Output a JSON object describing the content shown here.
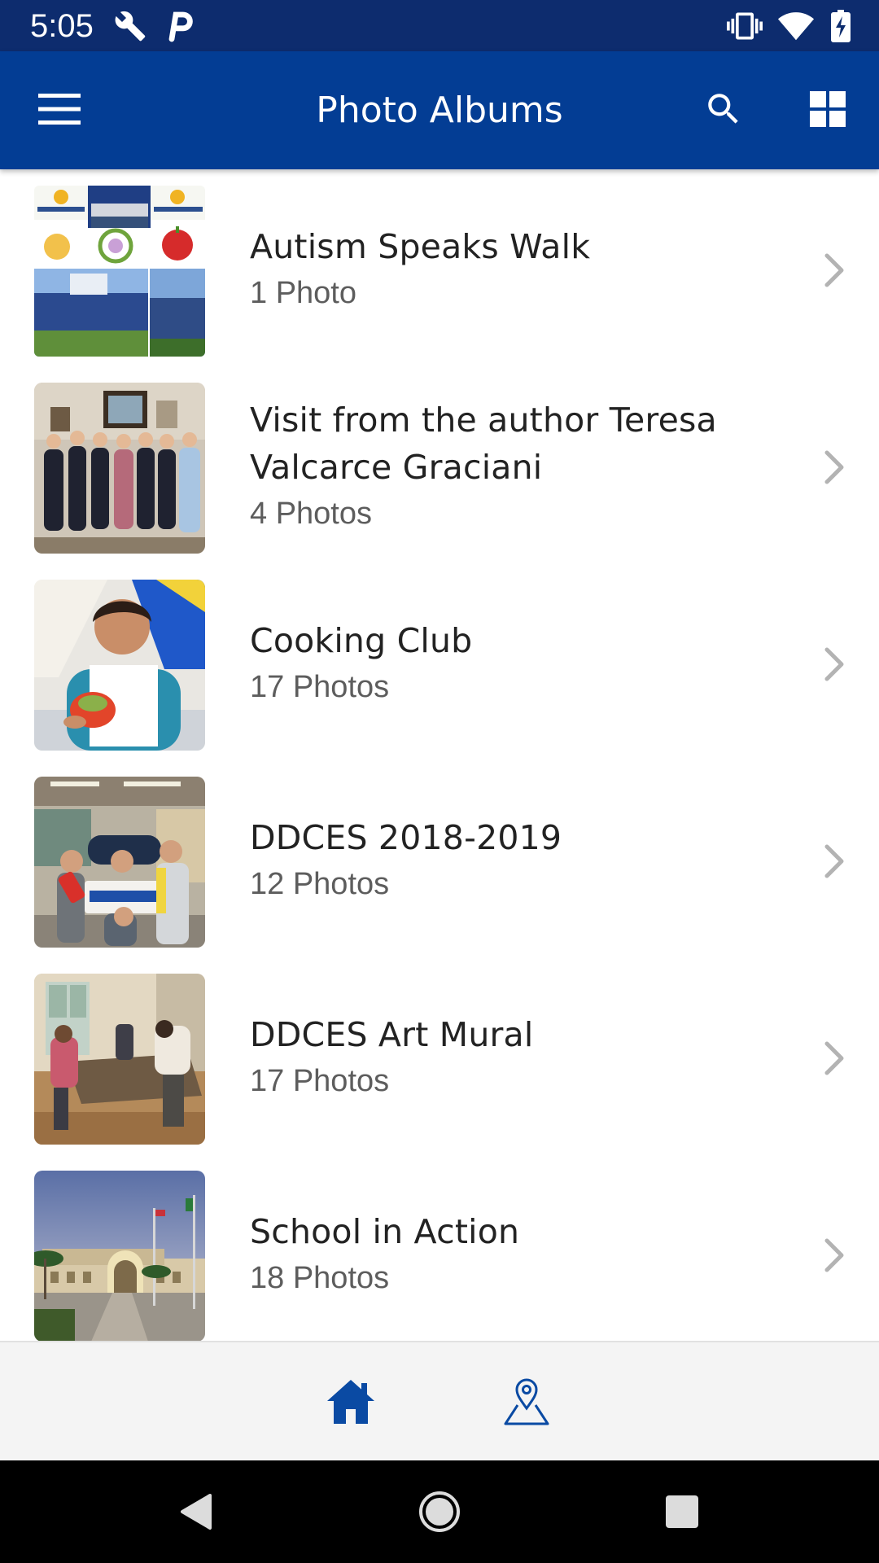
{
  "status_bar": {
    "time": "5:05",
    "left_icons": [
      "wrench-icon",
      "parking-icon"
    ],
    "right_icons": [
      "vibrate-icon",
      "wifi-icon",
      "battery-charging-icon"
    ]
  },
  "app_bar": {
    "title": "Photo Albums",
    "menu_icon": "hamburger-menu-icon",
    "search_icon": "search-icon",
    "grid_icon": "grid-view-icon",
    "background": "#033d94"
  },
  "albums": [
    {
      "title": "Autism Speaks Walk",
      "count": "1 Photo"
    },
    {
      "title": "Visit from the author Teresa Valcarce Graciani",
      "count": "4 Photos"
    },
    {
      "title": "Cooking Club",
      "count": "17 Photos"
    },
    {
      "title": "DDCES 2018-2019",
      "count": "12 Photos"
    },
    {
      "title": "DDCES Art Mural",
      "count": "17 Photos"
    },
    {
      "title": "School in Action",
      "count": "18 Photos"
    }
  ],
  "bottom_nav": {
    "items": [
      {
        "icon": "home-icon",
        "active": true
      },
      {
        "icon": "map-pin-icon",
        "active": false
      }
    ],
    "accent": "#0a4aa3"
  },
  "system_nav": [
    "back-icon",
    "home-circle-icon",
    "recents-icon"
  ]
}
